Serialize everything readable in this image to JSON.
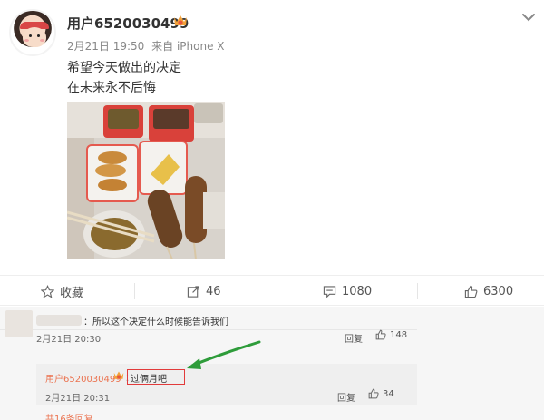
{
  "post": {
    "username": "用户6520030499",
    "vip_icon": "vip-badge-icon",
    "date": "2月21日 19:50",
    "source": "来自 iPhone X",
    "content_lines": [
      "希望今天做出的决定",
      "在未来永不后悔"
    ],
    "photo_icon": "food-photo"
  },
  "actions": {
    "favorite_label": "收藏",
    "repost_count": "46",
    "comment_count": "1080",
    "like_count": "6300"
  },
  "comment": {
    "text": "：所以这个决定什么时候能告诉我们",
    "date": "2月21日 20:30",
    "reply_label": "回复",
    "like_count": "148"
  },
  "subreply": {
    "username": "用户6520030499",
    "colon": "：",
    "text": "过俩月吧",
    "date": "2月21日 20:31",
    "reply_label": "回复",
    "like_count": "34"
  },
  "more_replies": "共16条回复",
  "colors": {
    "accent": "#eb7350",
    "highlight_box": "#e23b3b",
    "arrow": "#2e9c3a"
  }
}
